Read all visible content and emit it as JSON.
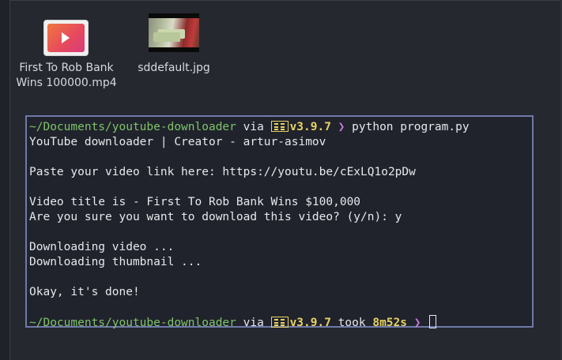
{
  "desktop": {
    "items": [
      {
        "name_line1": "First To Rob Bank",
        "name_line2": "Wins 100000.mp4",
        "icon": "video-file-icon"
      },
      {
        "name_line1": "sddefault.jpg",
        "icon": "image-thumbnail-icon"
      }
    ]
  },
  "terminal": {
    "prompt1": {
      "path": "~/Documents/youtube-downloader",
      "via": " via ",
      "python_icon": "python-icon",
      "version": "v3.9.7",
      "chevron": " ❯ ",
      "command": "python program.py"
    },
    "output": {
      "header": "YouTube downloader | Creator - artur-asimov",
      "paste": "Paste your video link here: https://youtu.be/cExLQ1o2pDw",
      "title": "Video title is - First To Rob Bank Wins $100,000",
      "confirm": "Are you sure you want to download this video? (y/n): y",
      "dl_video": "Downloading video ...",
      "dl_thumb": "Downloading thumbnail ...",
      "done": "Okay, it's done!"
    },
    "prompt2": {
      "path": "~/Documents/youtube-downloader",
      "via": " via ",
      "version": "v3.9.7",
      "took": " took ",
      "duration": "8m52s",
      "chevron": " ❯ "
    }
  },
  "colors": {
    "background": "#25282f",
    "terminal_border": "#6f7aa8",
    "path_green": "#7fc36b",
    "version_yellow": "#e8d264",
    "chevron_purple": "#c678dd"
  }
}
